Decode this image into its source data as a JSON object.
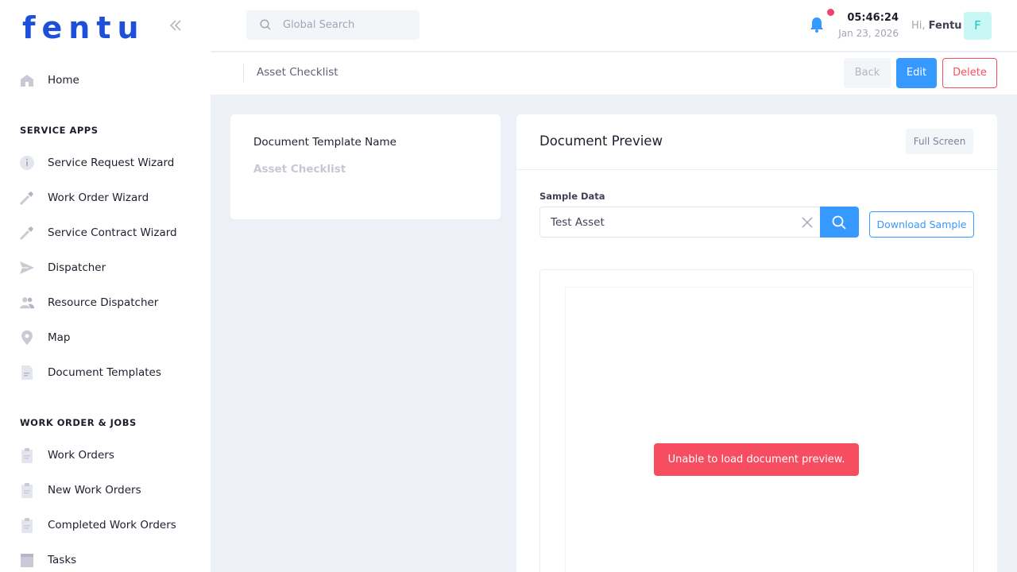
{
  "brand": {
    "logo_text": "fentu"
  },
  "sidebar": {
    "home": {
      "label": "Home"
    },
    "sections": [
      {
        "title": "SERVICE APPS"
      },
      {
        "title": "WORK ORDER & JOBS"
      }
    ],
    "service_apps": [
      {
        "label": "Service Request Wizard",
        "icon": "info-icon"
      },
      {
        "label": "Work Order Wizard",
        "icon": "tool-icon"
      },
      {
        "label": "Service Contract Wizard",
        "icon": "tool-icon"
      },
      {
        "label": "Dispatcher",
        "icon": "send-icon"
      },
      {
        "label": "Resource Dispatcher",
        "icon": "users-icon"
      },
      {
        "label": "Map",
        "icon": "map-pin-icon"
      },
      {
        "label": "Document Templates",
        "icon": "document-icon"
      }
    ],
    "work_orders": [
      {
        "label": "Work Orders",
        "icon": "clipboard-icon"
      },
      {
        "label": "New Work Orders",
        "icon": "clipboard-icon"
      },
      {
        "label": "Completed Work Orders",
        "icon": "clipboard-icon"
      },
      {
        "label": "Tasks",
        "icon": "tasks-icon"
      }
    ]
  },
  "header": {
    "search_placeholder": "Global Search",
    "time": "05:46:24",
    "date": "Jan 23, 2026",
    "greeting_prefix": "Hi,",
    "user_name": "Fentu",
    "avatar_initial": "F"
  },
  "subheader": {
    "title": "Asset Checklist",
    "back_label": "Back",
    "edit_label": "Edit",
    "delete_label": "Delete"
  },
  "template_card": {
    "field_label": "Document Template Name",
    "field_value": "Asset Checklist"
  },
  "preview": {
    "title": "Document Preview",
    "fullscreen_label": "Full Screen",
    "sample_label": "Sample Data",
    "sample_value": "Test Asset",
    "download_label": "Download Sample",
    "error_message": "Unable to load document preview."
  },
  "colors": {
    "primary": "#3699ff",
    "danger": "#f64e60",
    "brand": "#1e4fd8",
    "background": "#eef0f8"
  }
}
